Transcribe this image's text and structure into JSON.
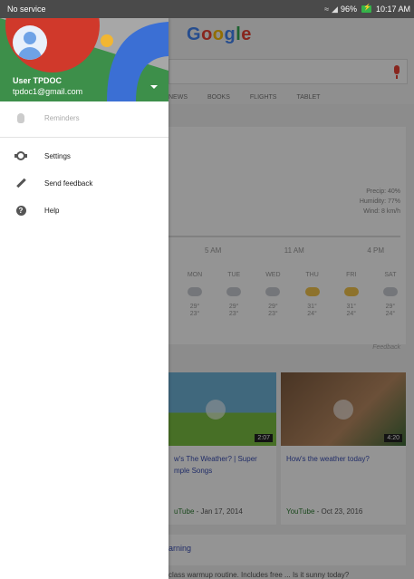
{
  "status_bar": {
    "carrier": "No service",
    "battery": "96%",
    "time": "10:17 AM",
    "battery_color": "#35b34a"
  },
  "background": {
    "logo_letters": [
      "G",
      "o",
      "o",
      "g",
      "l",
      "e"
    ],
    "tabs": [
      "NEWS",
      "BOOKS",
      "FLIGHTS",
      "TABLET"
    ],
    "weather": {
      "details": [
        "Precip: 40%",
        "Humidity: 77%",
        "Wind: 8 km/h"
      ],
      "times": [
        "5 AM",
        "11 AM",
        "4 PM"
      ],
      "days": [
        {
          "name": "MON",
          "high": "29°",
          "low": "23°",
          "icon": "rain-icon"
        },
        {
          "name": "TUE",
          "high": "29°",
          "low": "23°",
          "icon": "rain-icon"
        },
        {
          "name": "WED",
          "high": "29°",
          "low": "23°",
          "icon": "cloud-icon"
        },
        {
          "name": "THU",
          "high": "31°",
          "low": "24°",
          "icon": "sun-cloud-icon"
        },
        {
          "name": "FRI",
          "high": "31°",
          "low": "24°",
          "icon": "sun-cloud-icon"
        },
        {
          "name": "SAT",
          "high": "29°",
          "low": "24°",
          "icon": "rain-icon"
        }
      ],
      "feedback": "Feedback"
    },
    "videos": [
      {
        "title": "w's The Weather? | Super mple Songs",
        "source": "uTube",
        "date": " - Jan 17, 2014",
        "duration": "2:07"
      },
      {
        "title": "How's the weather today?",
        "source": "YouTube",
        "date": " - Oct 23, 2016",
        "duration": "4:20"
      }
    ],
    "learning_title": "arning",
    "snippet": "class warmup routine. Includes free ... Is it sunny today?"
  },
  "drawer": {
    "user_name": "User TPDOC",
    "user_email": "tpdoc1@gmail.com",
    "items": [
      {
        "label": "Reminders",
        "icon": "hand-icon"
      },
      {
        "label": "Settings",
        "icon": "gear-icon"
      },
      {
        "label": "Send feedback",
        "icon": "pencil-icon"
      },
      {
        "label": "Help",
        "icon": "help-icon"
      }
    ]
  }
}
